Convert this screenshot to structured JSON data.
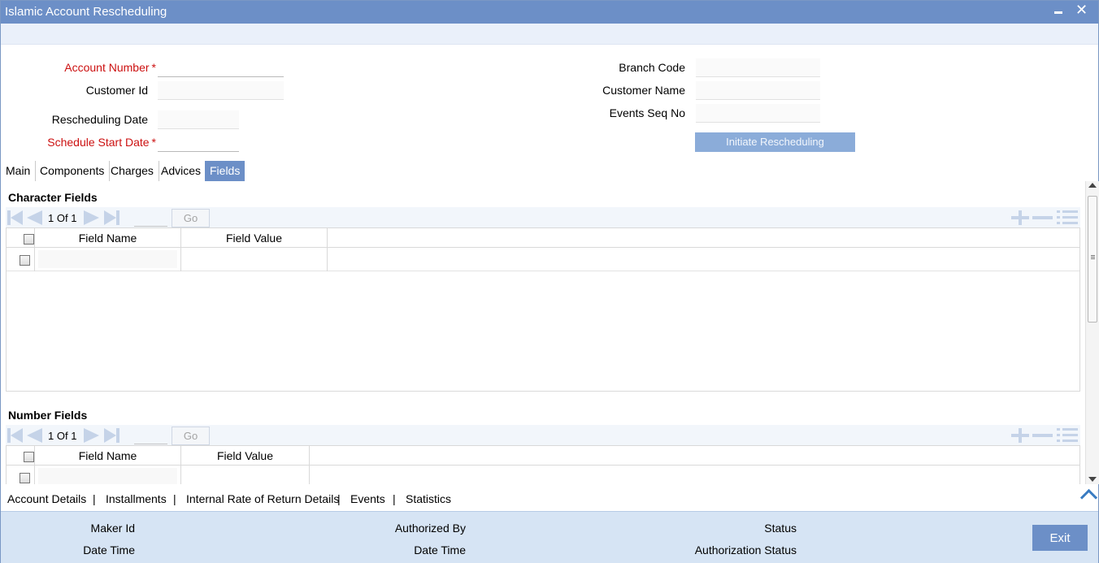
{
  "window": {
    "title": "Islamic Account Rescheduling"
  },
  "form": {
    "account_number_label": "Account Number",
    "customer_id_label": "Customer Id",
    "rescheduling_date_label": "Rescheduling Date",
    "schedule_start_date_label": "Schedule Start Date",
    "branch_code_label": "Branch Code",
    "customer_name_label": "Customer Name",
    "events_seq_no_label": "Events Seq No",
    "required_mark": "*",
    "initiate_button": "Initiate Rescheduling"
  },
  "tabs": [
    {
      "label": "Main"
    },
    {
      "label": "Components"
    },
    {
      "label": "Charges"
    },
    {
      "label": "Advices"
    },
    {
      "label": "Fields",
      "active": true
    }
  ],
  "character_fields": {
    "title": "Character Fields",
    "pager": {
      "current": "1",
      "of_label": "Of",
      "total": "1",
      "go_label": "Go"
    },
    "columns": [
      "Field Name",
      "Field Value"
    ]
  },
  "number_fields": {
    "title": "Number Fields",
    "pager": {
      "current": "1",
      "of_label": "Of",
      "total": "1",
      "go_label": "Go"
    },
    "columns": [
      "Field Name",
      "Field Value"
    ]
  },
  "bottom_links": [
    "Account Details",
    "Installments",
    "Internal Rate of Return Details",
    "Events",
    "Statistics"
  ],
  "bottom_separator": "|",
  "footer": {
    "maker_id": "Maker Id",
    "date_time": "Date Time",
    "authorized_by": "Authorized By",
    "date_time_2": "Date Time",
    "status": "Status",
    "authorization_status": "Authorization Status",
    "exit_button": "Exit"
  },
  "icons": {
    "minimize": "minimize-icon",
    "close": "close-icon",
    "first": "first-page-icon",
    "prev": "previous-page-icon",
    "next": "next-page-icon",
    "last": "last-page-icon",
    "add_row": "add-row-icon",
    "delete_row": "delete-row-icon",
    "single_view": "single-record-view-icon",
    "collapse": "chevron-up-icon"
  },
  "colors": {
    "title_bar": "#6c8fc7",
    "required": "#cc1111",
    "footer": "#d6e4f4",
    "button_disabled": "#8bacd9"
  }
}
